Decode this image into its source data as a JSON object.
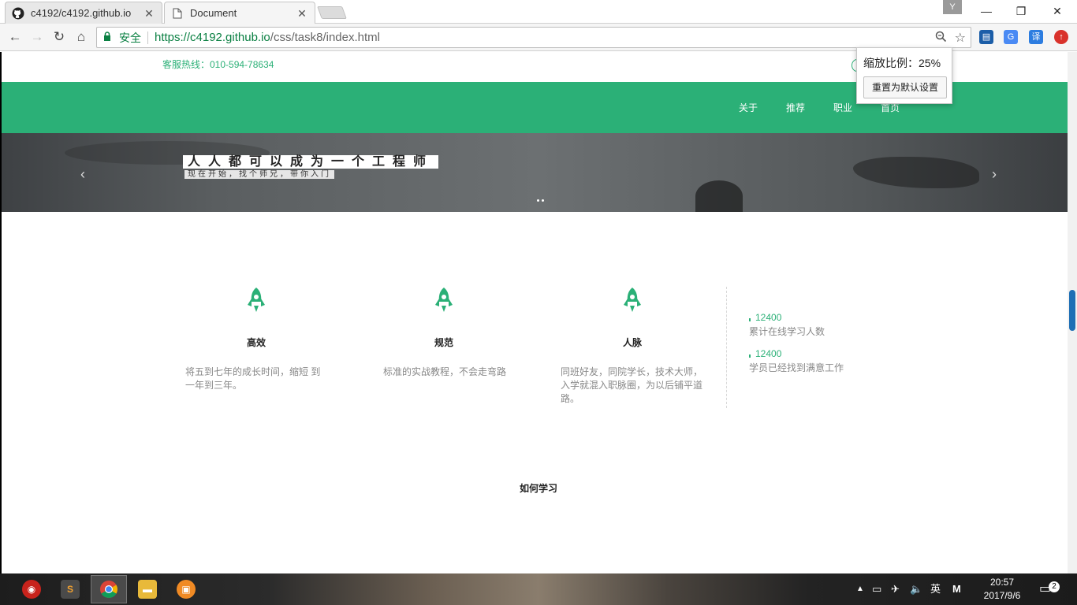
{
  "browser": {
    "tabs": [
      {
        "title": "c4192/c4192.github.io",
        "icon": "github-icon"
      },
      {
        "title": "Document",
        "icon": "document-icon"
      }
    ],
    "profile_badge": "Y",
    "omnibox": {
      "secure_label": "安全",
      "url_host": "https://c4192.github.io",
      "url_path": "/css/task8/index.html"
    },
    "zoom_popup": {
      "label": "缩放比例：25%",
      "reset_label": "重置为默认设置"
    },
    "extensions": [
      "extension-icon",
      "translate-icon",
      "translate-alt-icon",
      "extension-red-icon"
    ],
    "extension_labels": {
      "translate_alt": "译"
    }
  },
  "page": {
    "hotline": "客服热线：010-594-78634",
    "nav": [
      "关于",
      "推荐",
      "职业",
      "首页"
    ],
    "banner": {
      "title": "人人都可以成为一个工程师",
      "subtitle": "现在开始，找个师兄，带你入门"
    },
    "features": [
      {
        "title": "高效",
        "desc": "将五到七年的成长时间，缩短 到一年到三年。"
      },
      {
        "title": "规范",
        "desc": "标准的实战教程，不会走弯路"
      },
      {
        "title": "人脉",
        "desc": "同班好友，同院学长，技术大师，入学就混入职脉圈，为以后铺平道路。"
      }
    ],
    "stats": [
      {
        "number": "12400",
        "label": "累计在线学习人数"
      },
      {
        "number": "12400",
        "label": "学员已经找到满意工作"
      }
    ],
    "section_title": "如何学习",
    "accent_color": "#2bb077"
  },
  "taskbar": {
    "tray": {
      "ime": "英",
      "ime2": "M",
      "notifications": "2"
    },
    "clock": {
      "time": "20:57",
      "date": "2017/9/6"
    }
  }
}
